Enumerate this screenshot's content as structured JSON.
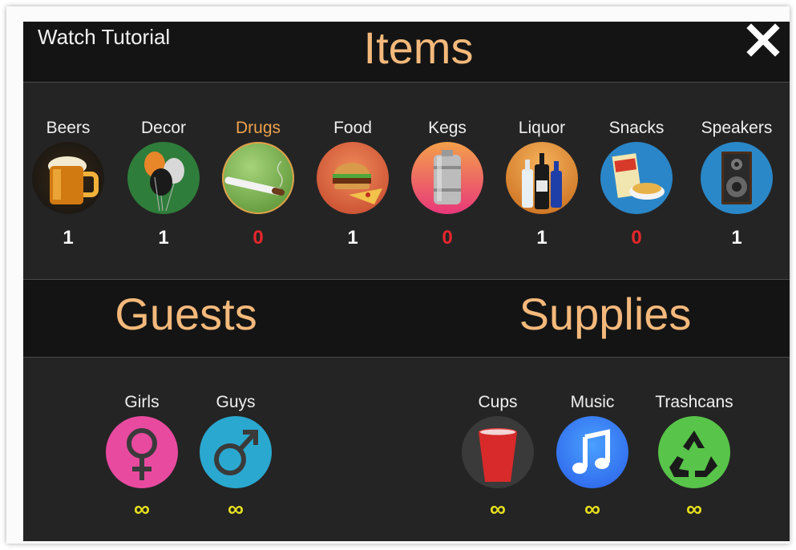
{
  "header": {
    "watch_tutorial": "Watch Tutorial",
    "title": "Items",
    "close": "X"
  },
  "items": [
    {
      "label": "Beers",
      "count": "1",
      "icon": "beer-mug-icon"
    },
    {
      "label": "Decor",
      "count": "1",
      "icon": "balloons-icon"
    },
    {
      "label": "Drugs",
      "count": "0",
      "icon": "joint-icon"
    },
    {
      "label": "Food",
      "count": "1",
      "icon": "burger-pizza-icon"
    },
    {
      "label": "Kegs",
      "count": "0",
      "icon": "keg-icon"
    },
    {
      "label": "Liquor",
      "count": "1",
      "icon": "liquor-bottles-icon"
    },
    {
      "label": "Snacks",
      "count": "0",
      "icon": "snacks-icon"
    },
    {
      "label": "Speakers",
      "count": "1",
      "icon": "speaker-icon"
    }
  ],
  "sections": {
    "guests_title": "Guests",
    "supplies_title": "Supplies"
  },
  "guests": [
    {
      "label": "Girls",
      "count": "∞",
      "icon": "female-symbol-icon"
    },
    {
      "label": "Guys",
      "count": "∞",
      "icon": "male-symbol-icon"
    }
  ],
  "supplies": [
    {
      "label": "Cups",
      "count": "∞",
      "icon": "red-cup-icon"
    },
    {
      "label": "Music",
      "count": "∞",
      "icon": "music-note-icon"
    },
    {
      "label": "Trashcans",
      "count": "∞",
      "icon": "recycle-icon"
    }
  ],
  "colors": {
    "accent": "#f4b97b",
    "selected": "#f0a24b",
    "zero": "#e8262b",
    "infinity": "#e9e21c"
  }
}
